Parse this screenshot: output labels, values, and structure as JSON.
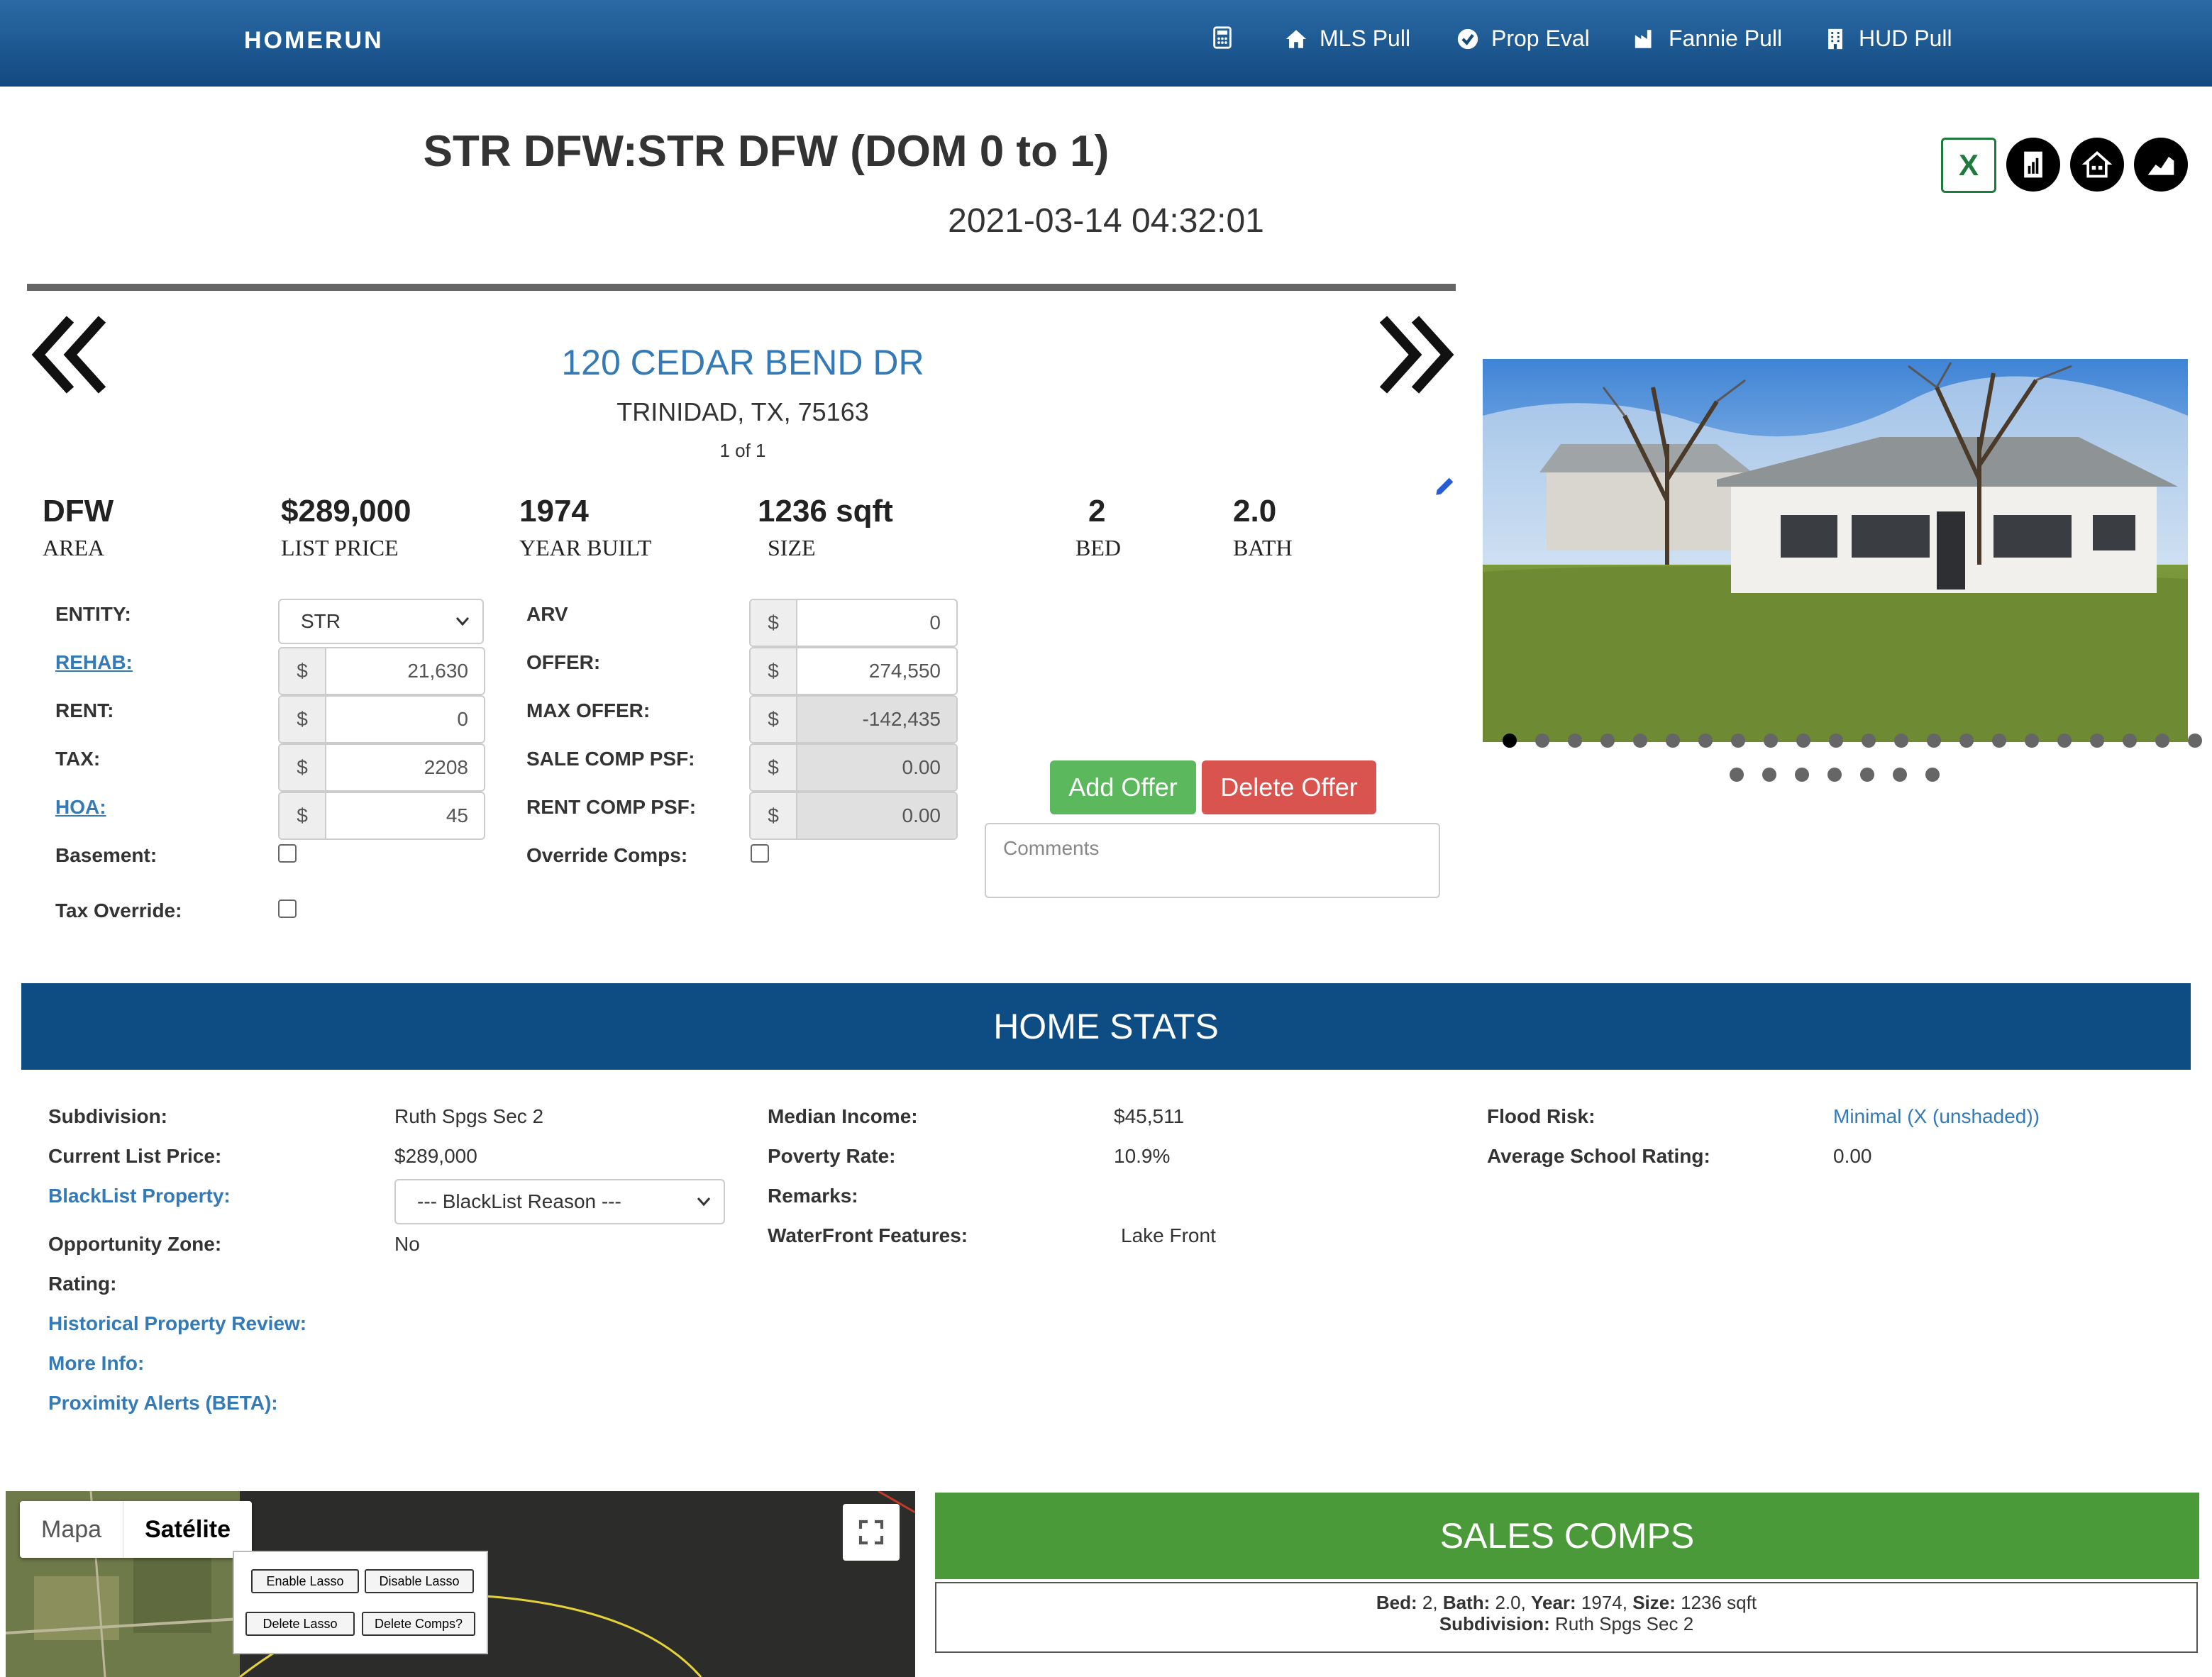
{
  "nav": {
    "logo": "HOMERUN",
    "items": [
      {
        "label": "MLS Pull",
        "icon": "home-icon"
      },
      {
        "label": "Prop Eval",
        "icon": "check-circle-icon"
      },
      {
        "label": "Fannie Pull",
        "icon": "factory-icon"
      },
      {
        "label": "HUD Pull",
        "icon": "building-icon"
      }
    ],
    "calculator_icon": "calculator-icon"
  },
  "header": {
    "title": "STR DFW:STR DFW (DOM 0 to 1)",
    "datetime": "2021-03-14 04:32:01"
  },
  "property": {
    "street": "120 CEDAR BEND DR",
    "city_line": "TRINIDAD, TX, 75163",
    "position": "1 of 1",
    "photo_dot_count": 29,
    "active_photo": 1
  },
  "stats": [
    {
      "value": "DFW",
      "label": "AREA"
    },
    {
      "value": "$289,000",
      "label": "LIST PRICE"
    },
    {
      "value": "1974",
      "label": "YEAR BUILT"
    },
    {
      "value": "1236 sqft",
      "label": "SIZE"
    },
    {
      "value": "2",
      "label": "BED"
    },
    {
      "value": "2.0",
      "label": "BATH"
    }
  ],
  "form": {
    "left": {
      "entity_label": "ENTITY:",
      "entity_value": "STR",
      "rehab_label": "REHAB:",
      "rehab_value": "21,630",
      "rent_label": "RENT:",
      "rent_value": "0",
      "tax_label": "TAX:",
      "tax_value": "2208",
      "hoa_label": "HOA:",
      "hoa_value": "45",
      "basement_label": "Basement:",
      "tax_override_label": "Tax Override:"
    },
    "right": {
      "arv_label": "ARV",
      "arv_value": "0",
      "offer_label": "OFFER:",
      "offer_value": "274,550",
      "max_offer_label": "MAX OFFER:",
      "max_offer_value": "-142,435",
      "sale_comp_label": "SALE COMP PSF:",
      "sale_comp_value": "0.00",
      "rent_comp_label": "RENT COMP PSF:",
      "rent_comp_value": "0.00",
      "override_label": "Override Comps:"
    },
    "currency": "$",
    "add_offer": "Add Offer",
    "delete_offer": "Delete Offer",
    "comments_placeholder": "Comments"
  },
  "home_stats": {
    "title": "HOME STATS",
    "col1": {
      "subdivision_label": "Subdivision:",
      "subdivision_value": "Ruth Spgs Sec 2",
      "list_price_label": "Current List Price:",
      "list_price_value": "$289,000",
      "blacklist_label": "BlackList Property:",
      "blacklist_value": "--- BlackList Reason ---",
      "opportunity_label": "Opportunity Zone:",
      "opportunity_value": "No",
      "rating_label": "Rating:",
      "historical_label": "Historical Property Review:",
      "more_info_label": "More Info:",
      "proximity_label": "Proximity Alerts (BETA):"
    },
    "col2": {
      "median_income_label": "Median Income:",
      "median_income_value": "$45,511",
      "poverty_label": "Poverty Rate:",
      "poverty_value": "10.9%",
      "remarks_label": "Remarks:",
      "waterfront_label": "WaterFront Features:",
      "waterfront_value": "Lake Front"
    },
    "col3": {
      "flood_label": "Flood Risk:",
      "flood_value": "Minimal (X (unshaded))",
      "school_label": "Average School Rating:",
      "school_value": "0.00"
    }
  },
  "map": {
    "map_tab": "Mapa",
    "satellite_tab": "Satélite",
    "enable_lasso": "Enable Lasso",
    "disable_lasso": "Disable Lasso",
    "delete_lasso": "Delete Lasso",
    "delete_comps": "Delete Comps?"
  },
  "sales_comps": {
    "title": "SALES COMPS",
    "bed_label": "Bed:",
    "bed_value": " 2, ",
    "bath_label": "Bath:",
    "bath_value": " 2.0, ",
    "year_label": "Year:",
    "year_value": " 1974, ",
    "size_label": "Size:",
    "size_value": " 1236 sqft",
    "subdivision_label": "Subdivision:",
    "subdivision_value": " Ruth Spgs Sec 2"
  },
  "colors": {
    "nav_blue": "#12497f",
    "link_blue": "#337ab7",
    "stats_blue": "#0e4c84",
    "add_green": "#5cb85c",
    "delete_red": "#d9534f",
    "sales_green": "#4b9a3a"
  }
}
